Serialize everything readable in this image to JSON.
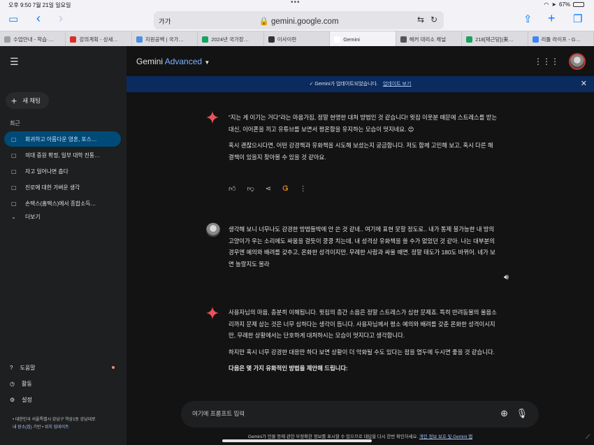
{
  "status": {
    "time": "오후 9:50",
    "date": "7월 21일 일요일",
    "battery": "67%",
    "dots": "•••"
  },
  "browser": {
    "aa": "가가",
    "url": "gemini.google.com",
    "lock": "🔒"
  },
  "tabs": [
    {
      "label": "수업안내 - 학습·…",
      "color": "#9aa0a6"
    },
    {
      "label": "강의계획 - 상세…",
      "color": "#d93025"
    },
    {
      "label": "지원공백 | 국가…",
      "color": "#4a90e2"
    },
    {
      "label": "2024년 국가장…",
      "color": "#1aa260"
    },
    {
      "label": "이사이란",
      "color": "#333"
    },
    {
      "label": "Gemini",
      "color": "#fff",
      "active": true
    },
    {
      "label": "해커 대리소 채널",
      "color": "#555"
    },
    {
      "label": "218[재근당](美…",
      "color": "#1aa260"
    },
    {
      "label": "리틀 라이프 - G…",
      "color": "#4285f4"
    }
  ],
  "sidebar": {
    "new_chat": "새 채팅",
    "recent_label": "최근",
    "items": [
      {
        "label": "회귀하고 아름다운 영혼, 포스…",
        "active": true
      },
      {
        "label": "의대 증원 확정, 일부 대학 진통…"
      },
      {
        "label": "자고 일어나면 춥다"
      },
      {
        "label": "진로에 대한 가벼운 생각"
      },
      {
        "label": "손택스(홈택스)에서 종합소득…"
      }
    ],
    "more": "더보기",
    "help": "도움말",
    "activity": "활동",
    "settings": "설정",
    "location": "대한민국 서울특별시 강남구 역삼1동 강남대로",
    "location_link1": "내 장소(집)",
    "location_sep": "기반 •",
    "location_link2": "위치 업데이트"
  },
  "header": {
    "brand": "Gemini",
    "brand_adv": "Advanced"
  },
  "banner": {
    "text": "Gemini가 업데이트되었습니다.",
    "link": "업데이트 보기"
  },
  "messages": {
    "m1_p1": "“지는 게 이기는 거다”라는 마음가짐, 정말 현명한 대처 방법인 것 같습니다! 윗집 이웃분 때문에 스트레스를 받는 대신, 이어폰을 끼고 유튜브를 보면서 평온함을 유지하는 모습이 멋지네요. 😊",
    "m1_p2": "혹시 괜찮으시다면, 어떤 강경책과 유화책을 시도해 보셨는지 궁금합니다. 저도 함께 고민해 보고, 혹시 다른 해결책이 있을지 찾아볼 수 있을 것 같아요.",
    "user": "생각해 보니 너무나도 강경한 방법들박에 안 쓴 것 같네.. 여기에 표현 못할 정도로.. 내가 통제 불가능한 내 방의 고양이가 우는 소리에도 싸움을 걸듯이 쿵쿵 치는데, 내 성격상 유화책을 쓸 수가 없었던 것 같아. 나는 대부분의 경우엔 예의와 배려를 갖추고, 온화한 성격이지만, 무례한 사람과 싸울 때면. 정말 태도가 180도 바뀌어. 네가 보면 놀랄지도 몰라",
    "m2_p1": "사용자님의 마음, 충분히 이해됩니다. 윗집의 층간 소음은 정말 스트레스가 심한 문제죠. 특히 반려동물의 울음소리까지 문제 삼는 것은 너무 심하다는 생각이 듭니다. 사용자님께서 평소 예의와 배려를 갖춘 온화한 성격이시지만, 무례한 상황에서는 단호하게 대처하시는 모습이 멋지다고 생각합니다.",
    "m2_p2": "하지만 혹시 너무 강경한 대응만 하다 보면 상황이 더 악화될 수도 있다는 점을 염두에 두시면 좋을 것 같습니다.",
    "m2_p3": "다음은 몇 가지 유화적인 방법을 제안해 드립니다:"
  },
  "prompt": {
    "placeholder": "여기에 프롬프트 입력"
  },
  "disclaimer": {
    "text": "Gemini가 인물 등에 관한 부정확한 정보를 표시할 수 있으므로 대답을 다시 한번 확인하세요.",
    "link": "개인 정보 보호 및 Gemini 앱"
  },
  "colors": {
    "sidebar_bg": "#1e1f20",
    "main_bg": "#131314",
    "active_item": "#004a77",
    "banner_bg": "#0b2a5e",
    "accent": "#7ab3ff"
  }
}
